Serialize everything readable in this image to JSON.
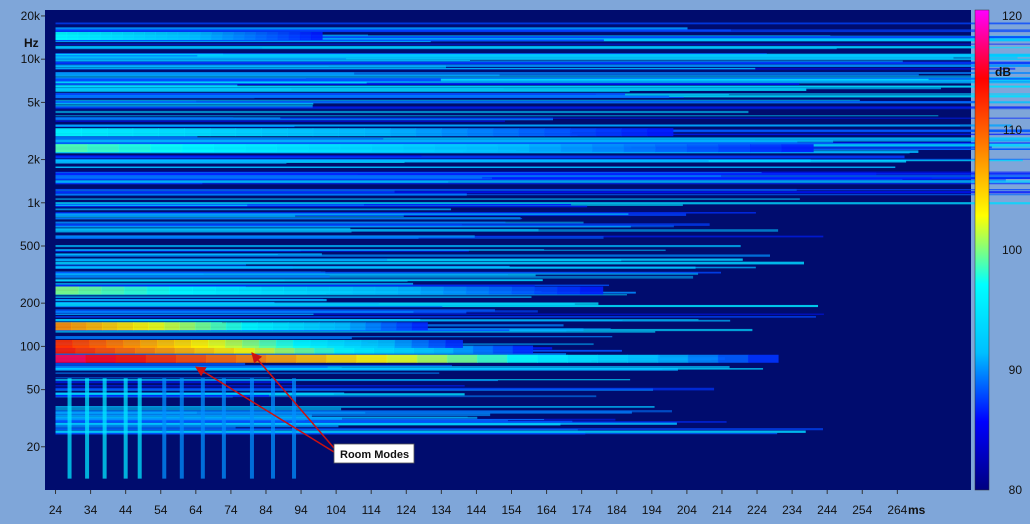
{
  "chart_data": {
    "type": "heatmap",
    "title": "",
    "xlabel": "ms",
    "ylabel": "Hz",
    "colorbar_label": "dB",
    "x_range": [
      21,
      285
    ],
    "y_range_hz": [
      10,
      22000
    ],
    "y_scale": "log",
    "color_range_db": [
      80,
      120
    ],
    "x_ticks": [
      "24",
      "34",
      "44",
      "54",
      "64",
      "74",
      "84",
      "94",
      "104",
      "114",
      "124",
      "134",
      "144",
      "154",
      "164",
      "174",
      "184",
      "194",
      "204",
      "214",
      "224",
      "234",
      "244",
      "254",
      "264"
    ],
    "y_ticks": [
      {
        "value": 20000,
        "label": "20k"
      },
      {
        "value": 10000,
        "label": "10k"
      },
      {
        "value": 5000,
        "label": "5k"
      },
      {
        "value": 2000,
        "label": "2k"
      },
      {
        "value": 1000,
        "label": "1k"
      },
      {
        "value": 500,
        "label": "500"
      },
      {
        "value": 200,
        "label": "200"
      },
      {
        "value": 100,
        "label": "100"
      },
      {
        "value": 50,
        "label": "50"
      },
      {
        "value": 20,
        "label": "20"
      }
    ],
    "colorbar_ticks": [
      120,
      110,
      100,
      90,
      80
    ],
    "colormap": [
      "#00007f",
      "#0000ff",
      "#00bfff",
      "#00ffff",
      "#ffff00",
      "#ff7f00",
      "#ff0000",
      "#ff00ff"
    ],
    "background_color": "#000c6e",
    "ridges": [
      {
        "freq": 82,
        "peak_db": 116,
        "decay_ms": 230
      },
      {
        "freq": 95,
        "peak_db": 113,
        "decay_ms": 160
      },
      {
        "freq": 104,
        "peak_db": 112,
        "decay_ms": 140
      },
      {
        "freq": 138,
        "peak_db": 108,
        "decay_ms": 130
      },
      {
        "freq": 245,
        "peak_db": 100,
        "decay_ms": 180
      },
      {
        "freq": 2400,
        "peak_db": 99,
        "decay_ms": 240
      },
      {
        "freq": 3100,
        "peak_db": 97,
        "decay_ms": 200
      },
      {
        "freq": 14500,
        "peak_db": 97,
        "decay_ms": 100
      }
    ],
    "annotation": {
      "text": "Room Modes",
      "targets": [
        {
          "x_ms": 80,
          "freq": 90
        },
        {
          "x_ms": 64,
          "freq": 72
        }
      ]
    }
  }
}
